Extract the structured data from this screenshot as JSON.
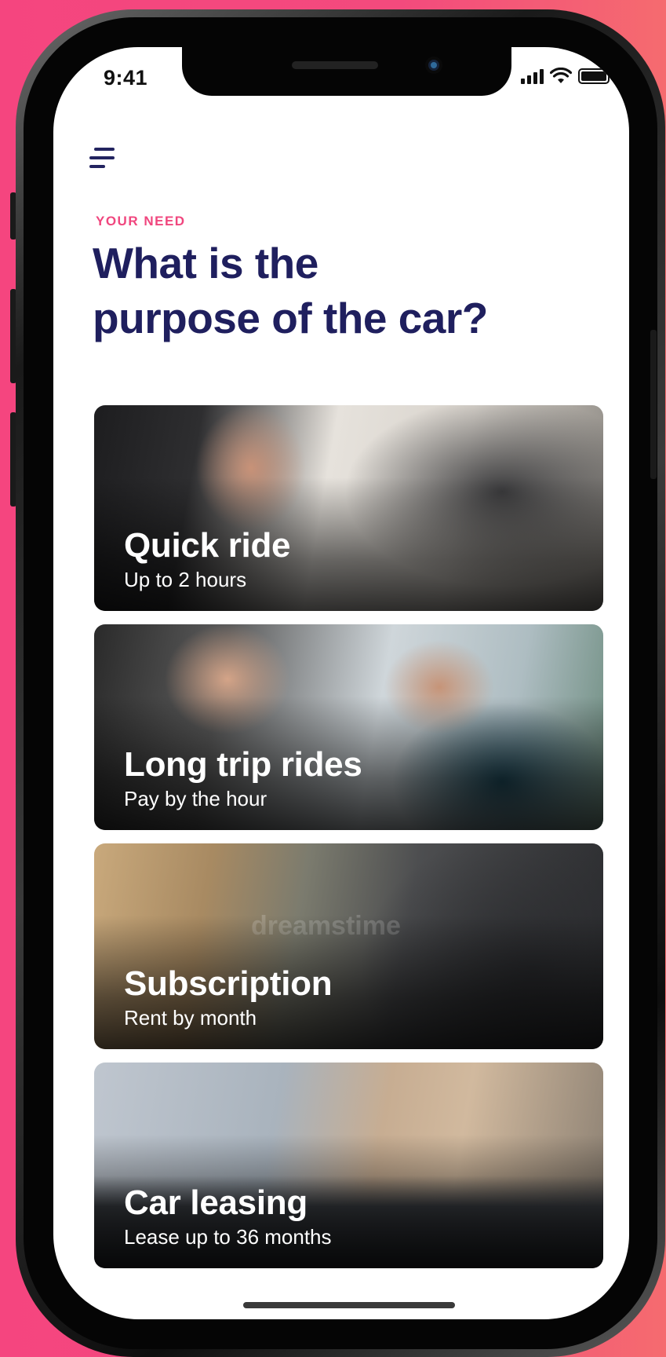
{
  "status_bar": {
    "time": "9:41"
  },
  "header": {
    "eyebrow": "YOUR NEED",
    "headline_line1": "What is the",
    "headline_line2": "purpose of the car?"
  },
  "cards": [
    {
      "title": "Quick ride",
      "subtitle": "Up to 2 hours"
    },
    {
      "title": "Long trip rides",
      "subtitle": "Pay by the hour"
    },
    {
      "title": "Subscription",
      "subtitle": "Rent by month",
      "watermark": "dreamstime"
    },
    {
      "title": "Car leasing",
      "subtitle": "Lease up to 36 months"
    }
  ],
  "colors": {
    "accent": "#f0467e",
    "headline": "#1f1f5e",
    "background": "#f5457f"
  }
}
